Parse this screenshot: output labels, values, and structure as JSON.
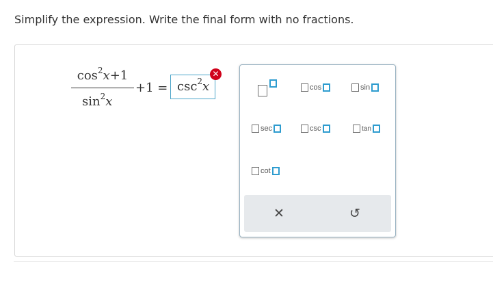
{
  "instructions": "Simplify the expression. Write the final form with no fractions.",
  "expression": {
    "numerator_fn": "cos",
    "numerator_exp": "2",
    "numerator_var": "x",
    "numerator_rest": "+1",
    "denominator_fn": "sin",
    "denominator_exp": "2",
    "denominator_var": "x",
    "after_fraction": "+1 ="
  },
  "answer": {
    "fn": "csc",
    "exp": "2",
    "var": "x",
    "status_icon": "error-x-icon",
    "status_symbol": "✕",
    "status_color": "#d0021b"
  },
  "palette": {
    "keys": [
      {
        "label": "cos"
      },
      {
        "label": "sin"
      },
      {
        "label": "sec"
      },
      {
        "label": "csc"
      },
      {
        "label": "tan"
      },
      {
        "label": "cot"
      }
    ],
    "clear_symbol": "✕",
    "undo_symbol": "↺"
  },
  "colors": {
    "accent_blue": "#2e9ccf",
    "error_red": "#d0021b",
    "toolbar_grey": "#e6e9ec"
  }
}
